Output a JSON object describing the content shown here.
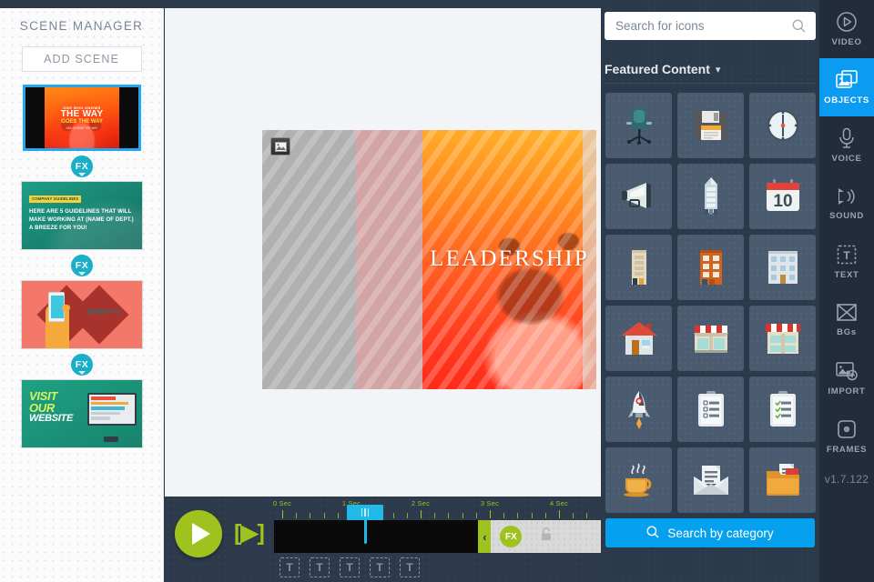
{
  "scene_manager": {
    "title": "SCENE MANAGER",
    "add_scene_label": "ADD SCENE",
    "fx_label": "FX",
    "scenes": [
      {
        "name": "leadership-the-way",
        "selected": true,
        "lines": [
          "ONE WHO KNOWS",
          "THE WAY",
          "GOES THE WAY",
          "AND SHOWS THE WAY"
        ]
      },
      {
        "name": "company-guidelines",
        "selected": false,
        "tag": "COMPANY GUIDELINES",
        "body": "HERE ARE 5 GUIDELINES THAT WILL MAKE WORKING AT (NAME OF DEPT.) A BREEZE FOR YOU!"
      },
      {
        "name": "benefit-2",
        "selected": false,
        "label": "BENEFIT 2"
      },
      {
        "name": "visit-our-website",
        "selected": false,
        "lines": [
          "VISIT",
          "OUR",
          "WEBSITE"
        ]
      }
    ]
  },
  "canvas": {
    "headline": "LEADERSHIP",
    "badge_icon": "image-icon"
  },
  "timeline": {
    "play_label": "play",
    "step_label": "[▶]",
    "fx_label": "FX",
    "lock_icon": "lock-icon",
    "handle_icon": "chevron-left-icon",
    "playhead_seconds": 1.2,
    "ruler": {
      "labels": [
        "0 Sec",
        "1 Sec",
        "2 Sec",
        "3 Sec",
        "4 Sec"
      ],
      "seconds_per_major": 1,
      "minor_per_major": 5
    },
    "text_markers": [
      "T",
      "T",
      "T",
      "T",
      "T"
    ]
  },
  "library": {
    "search": {
      "placeholder": "Search for icons",
      "value": "",
      "icon": "search-icon"
    },
    "section": {
      "title": "Featured Content",
      "chevron": "⌄"
    },
    "category_button": {
      "label": "Search by category",
      "icon": "search-icon",
      "color": "#06a1ee"
    },
    "icons": [
      {
        "name": "office-chair-icon",
        "label": "Office chair"
      },
      {
        "name": "floppy-disk-icon",
        "label": "Floppy disk"
      },
      {
        "name": "clock-icon",
        "label": "Clock"
      },
      {
        "name": "megaphone-icon",
        "label": "Megaphone"
      },
      {
        "name": "skyscraper-icon",
        "label": "Skyscraper"
      },
      {
        "name": "calendar-icon",
        "label": "Calendar 10"
      },
      {
        "name": "apartment-beige-icon",
        "label": "Beige building"
      },
      {
        "name": "apartment-orange-icon",
        "label": "Orange building"
      },
      {
        "name": "office-building-icon",
        "label": "Office building"
      },
      {
        "name": "house-icon",
        "label": "House"
      },
      {
        "name": "storefront-icon",
        "label": "Storefront"
      },
      {
        "name": "shop-awning-icon",
        "label": "Shop with awning"
      },
      {
        "name": "rocket-icon",
        "label": "Rocket"
      },
      {
        "name": "clipboard-list-icon",
        "label": "Clipboard list"
      },
      {
        "name": "clipboard-checklist-icon",
        "label": "Clipboard checklist"
      },
      {
        "name": "coffee-cup-icon",
        "label": "Coffee cup"
      },
      {
        "name": "open-envelope-icon",
        "label": "Open envelope"
      },
      {
        "name": "file-folder-icon",
        "label": "File folder"
      }
    ]
  },
  "rail": {
    "version": "v1.7.122",
    "items": [
      {
        "label": "VIDEO",
        "icon": "play-circle-icon",
        "active": false
      },
      {
        "label": "OBJECTS",
        "icon": "images-icon",
        "active": true
      },
      {
        "label": "VOICE",
        "icon": "microphone-icon",
        "active": false
      },
      {
        "label": "SOUND",
        "icon": "speaker-icon",
        "active": false
      },
      {
        "label": "TEXT",
        "icon": "text-box-icon",
        "active": false
      },
      {
        "label": "BGs",
        "icon": "background-icon",
        "active": false
      },
      {
        "label": "IMPORT",
        "icon": "import-image-icon",
        "active": false
      },
      {
        "label": "FRAMES",
        "icon": "frames-icon",
        "active": false
      }
    ]
  }
}
